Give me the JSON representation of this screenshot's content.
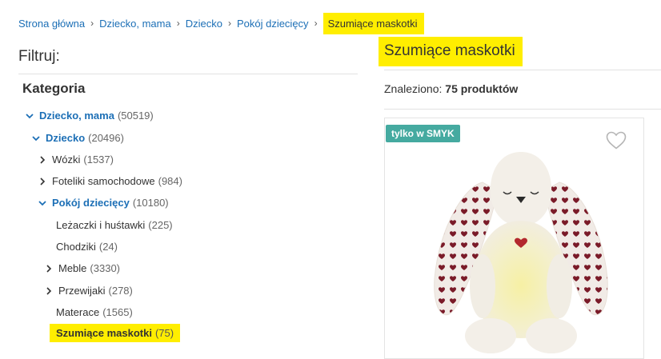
{
  "breadcrumb": {
    "items": [
      "Strona główna",
      "Dziecko, mama",
      "Dziecko",
      "Pokój dziecięcy"
    ],
    "current": "Szumiące maskotki",
    "separator": "›"
  },
  "filters": {
    "title": "Filtruj:",
    "category_title": "Kategoria",
    "categories": [
      {
        "label": "Dziecko, mama",
        "count": "(50519)"
      },
      {
        "label": "Dziecko",
        "count": "(20496)"
      },
      {
        "label": "Wózki",
        "count": "(1537)"
      },
      {
        "label": "Foteliki samochodowe",
        "count": "(984)"
      },
      {
        "label": "Pokój dziecięcy",
        "count": "(10180)"
      },
      {
        "label": "Leżaczki i huśtawki",
        "count": "(225)"
      },
      {
        "label": "Chodziki",
        "count": "(24)"
      },
      {
        "label": "Meble",
        "count": "(3330)"
      },
      {
        "label": "Przewijaki",
        "count": "(278)"
      },
      {
        "label": "Materace",
        "count": "(1565)"
      },
      {
        "label": "Szumiące maskotki",
        "count": "(75)"
      }
    ]
  },
  "results": {
    "title": "Szumiące maskotki",
    "found_label": "Znaleziono:",
    "found_count": "75 produktów"
  },
  "product": {
    "badge": "tylko w SMYK",
    "favorite_icon": "heart-outline-icon",
    "image": "plush-bunny-night-light"
  },
  "colors": {
    "link": "#1c6fb6",
    "highlight": "#ffee00",
    "badge": "#45aaa0"
  }
}
